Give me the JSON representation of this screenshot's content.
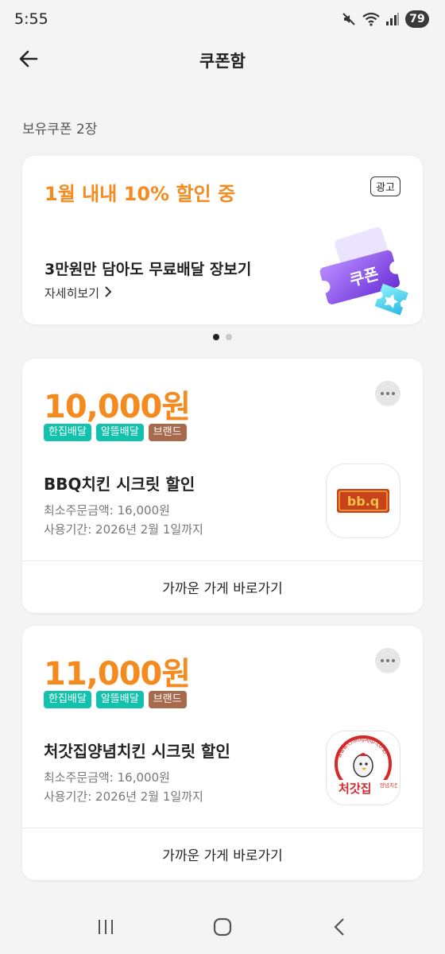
{
  "status_bar": {
    "time": "5:55",
    "battery": "79",
    "icons": [
      "mute-icon",
      "wifi-icon",
      "signal-icon"
    ]
  },
  "header": {
    "title": "쿠폰함",
    "back_icon": "arrow-left-icon"
  },
  "coupon_count": "보유쿠폰 2장",
  "ad_banner": {
    "headline": "1월 내내 10% 할인 중",
    "badge": "광고",
    "subtitle": "3만원만 담아도 무료배달 장보기",
    "link_label": "자세히보기",
    "illustration_text": "쿠폰",
    "accent_color": "#f58a1f"
  },
  "pager": {
    "count": 2,
    "active_index": 0
  },
  "coupons": [
    {
      "amount": "10,000원",
      "tags": [
        "한집배달",
        "알뜰배달",
        "브랜드"
      ],
      "name": "BBQ치킨 시크릿 할인",
      "min_order": "최소주문금액: 16,000원",
      "period": "사용기간: 2026년 2월 1일까지",
      "logo_text": "bb.q",
      "action_label": "가까운 가게 바로가기"
    },
    {
      "amount": "11,000원",
      "tags": [
        "한집배달",
        "알뜰배달",
        "브랜드"
      ],
      "name": "처갓집양념치킨 시크릿 할인",
      "min_order": "최소주문금액: 16,000원",
      "period": "사용기간: 2026년 2월 1일까지",
      "logo_text": "처갓집",
      "logo_url_text": "www.cheogajip.co.kr",
      "logo_sub_text": "양념치킨",
      "action_label": "가까운 가게 바로가기"
    }
  ],
  "nav_bar": {
    "icons": [
      "recent-apps-icon",
      "home-icon",
      "back-icon"
    ]
  },
  "colors": {
    "accent": "#f58a1f",
    "tag_teal": "#12c2ad",
    "tag_brown": "#a86a4d",
    "background": "#f4f4f4"
  }
}
